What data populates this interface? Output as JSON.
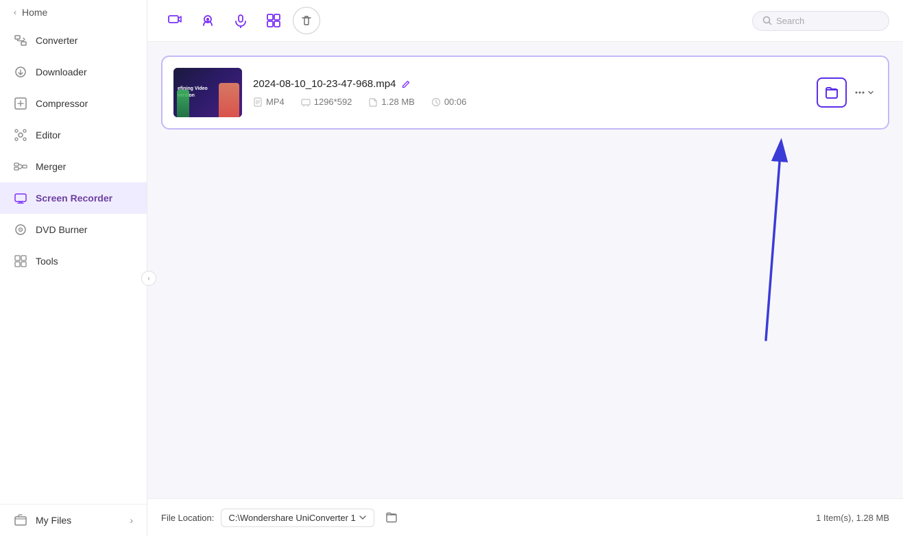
{
  "sidebar": {
    "home_label": "Home",
    "collapse_icon": "❮",
    "items": [
      {
        "id": "converter",
        "label": "Converter",
        "icon": "converter"
      },
      {
        "id": "downloader",
        "label": "Downloader",
        "icon": "downloader"
      },
      {
        "id": "compressor",
        "label": "Compressor",
        "icon": "compressor"
      },
      {
        "id": "editor",
        "label": "Editor",
        "icon": "editor"
      },
      {
        "id": "merger",
        "label": "Merger",
        "icon": "merger"
      },
      {
        "id": "screen-recorder",
        "label": "Screen Recorder",
        "icon": "screen-recorder",
        "active": true
      },
      {
        "id": "dvd-burner",
        "label": "DVD Burner",
        "icon": "dvd-burner"
      },
      {
        "id": "tools",
        "label": "Tools",
        "icon": "tools"
      }
    ],
    "my_files_label": "My Files",
    "my_files_arrow": "›"
  },
  "toolbar": {
    "search_placeholder": "Search"
  },
  "file_card": {
    "filename": "2024-08-10_10-23-47-968.mp4",
    "format": "MP4",
    "resolution": "1296*592",
    "size": "1.28 MB",
    "duration": "00:06"
  },
  "bottom_bar": {
    "file_location_label": "File Location:",
    "location_path": "C:\\Wondershare UniConverter 1",
    "items_summary": "1 Item(s), 1.28 MB"
  },
  "colors": {
    "accent": "#7b2ff7",
    "accent_border": "#5b2ee8",
    "sidebar_active_bg": "#f0ecff"
  }
}
